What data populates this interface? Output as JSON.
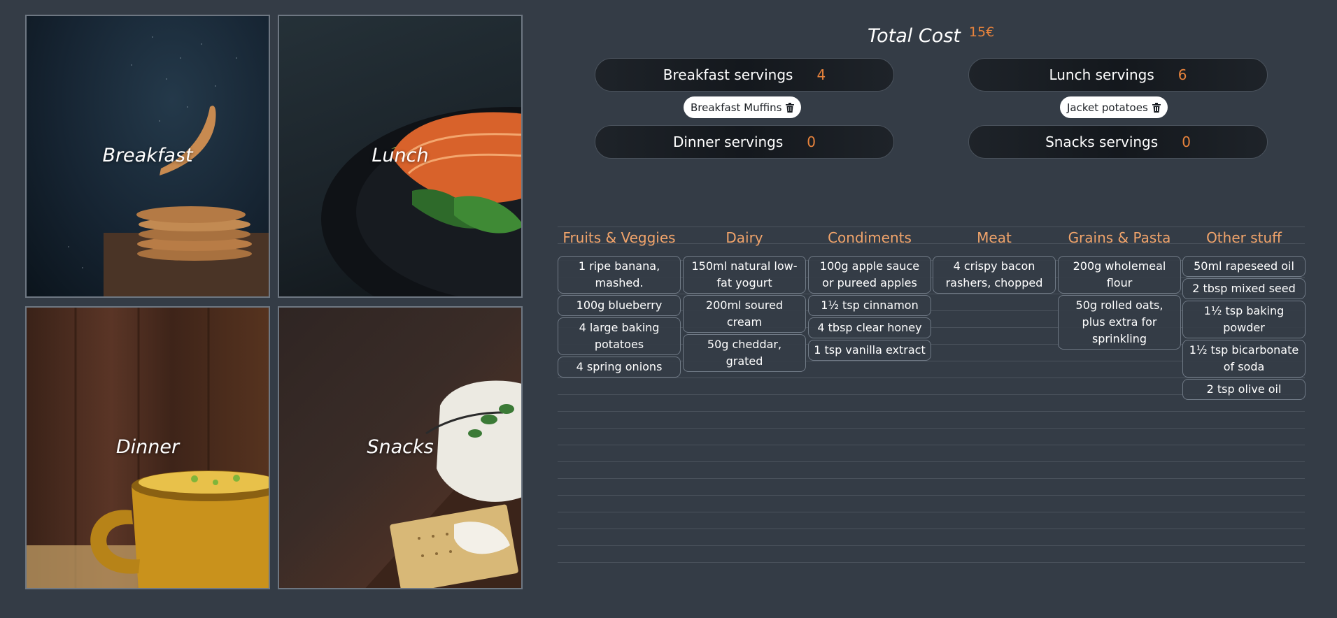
{
  "tiles": [
    {
      "id": "breakfast",
      "label": "Breakfast"
    },
    {
      "id": "lunch",
      "label": "Lunch"
    },
    {
      "id": "dinner",
      "label": "Dinner"
    },
    {
      "id": "snacks",
      "label": "Snacks"
    }
  ],
  "total": {
    "label": "Total Cost",
    "value": "15€"
  },
  "servings": {
    "breakfast": {
      "label": "Breakfast servings",
      "count": "4"
    },
    "lunch": {
      "label": "Lunch servings",
      "count": "6"
    },
    "dinner": {
      "label": "Dinner servings",
      "count": "0"
    },
    "snacks": {
      "label": "Snacks servings",
      "count": "0"
    }
  },
  "selected": {
    "breakfast": {
      "label": "Breakfast Muffins",
      "icon": "trash-icon"
    },
    "lunch": {
      "label": "Jacket potatoes",
      "icon": "trash-icon"
    }
  },
  "shopping": {
    "columns": [
      {
        "title": "Fruits & Veggies",
        "items": [
          "1 ripe banana, mashed.",
          "100g blueberry",
          "4 large baking potatoes",
          "4 spring onions"
        ]
      },
      {
        "title": "Dairy",
        "items": [
          "150ml natural low-fat yogurt",
          "200ml soured cream",
          "50g cheddar, grated"
        ]
      },
      {
        "title": "Condiments",
        "items": [
          "100g apple sauce or pureed apples",
          "1½ tsp cinnamon",
          "4 tbsp clear honey",
          "1 tsp vanilla extract"
        ]
      },
      {
        "title": "Meat",
        "items": [
          "4 crispy bacon rashers, chopped"
        ]
      },
      {
        "title": "Grains & Pasta",
        "items": [
          "200g wholemeal flour",
          "50g rolled oats, plus extra for sprinkling"
        ]
      },
      {
        "title": "Other stuff",
        "items": [
          "50ml rapeseed oil",
          "2 tbsp mixed seed",
          "1½ tsp baking powder",
          "1½ tsp bicarbonate of soda",
          "2 tsp olive oil"
        ]
      }
    ]
  },
  "colors": {
    "accent": "#e8833c",
    "header": "#f1a46b",
    "background": "#343c46"
  }
}
